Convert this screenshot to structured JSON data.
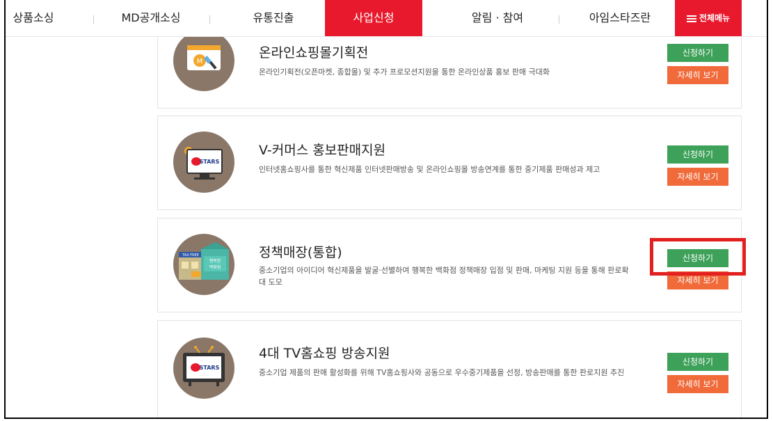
{
  "nav": {
    "items": [
      "상품소싱",
      "MD공개소싱",
      "유통진출",
      "사업신청",
      "알림 · 참여",
      "아임스타즈란"
    ],
    "active": "사업신청",
    "menu_label": "전체메뉴",
    "accent_color": "#e8192c"
  },
  "programs": [
    {
      "title": "온라인쇼핑몰기획전",
      "description": "온라인기획전(오픈마켓, 종합몰) 및 추가 프로모션지원을 통한 온라인상품 홍보 판매 극대화",
      "apply_label": "신청하기",
      "detail_label": "자세히 보기",
      "icon": "online-mall-icon"
    },
    {
      "title": "V-커머스 홍보판매지원",
      "description": "인터넷홈쇼핑사를 통한 혁신제품 인터넷판매방송 및 온라인쇼핑몰 방송연계를 통한 중기제품 판매성과 제고",
      "apply_label": "신청하기",
      "detail_label": "자세히 보기",
      "icon": "monitor-stars-icon",
      "icon_text": "STARS"
    },
    {
      "title": "정책매장(통합)",
      "description": "중소기업의 아이디어 혁신제품을 발굴·선별하여 행복한 백화점 정책매장 입점 및 판매, 마케팅 지원 등을 통해 판로확대 도모",
      "apply_label": "신청하기",
      "detail_label": "자세히 보기",
      "icon": "policy-store-icon",
      "icon_text": [
        "TAX FREE",
        "행복한",
        "백화점"
      ]
    },
    {
      "title": "4대 TV홈쇼핑 방송지원",
      "description": "중소기업 제품의 판매 활성화를 위해 TV홈쇼핑사와 공동으로 우수중기제품을 선정, 방송판매를 통한 판로지원 추진",
      "apply_label": "신청하기",
      "detail_label": "자세히 보기",
      "icon": "tv-stars-icon",
      "icon_text": "STARS"
    }
  ],
  "colors": {
    "apply_button": "#3ea15a",
    "detail_button": "#f06a3a",
    "highlight": "#e32020",
    "icon_circle": "#8a7768"
  }
}
